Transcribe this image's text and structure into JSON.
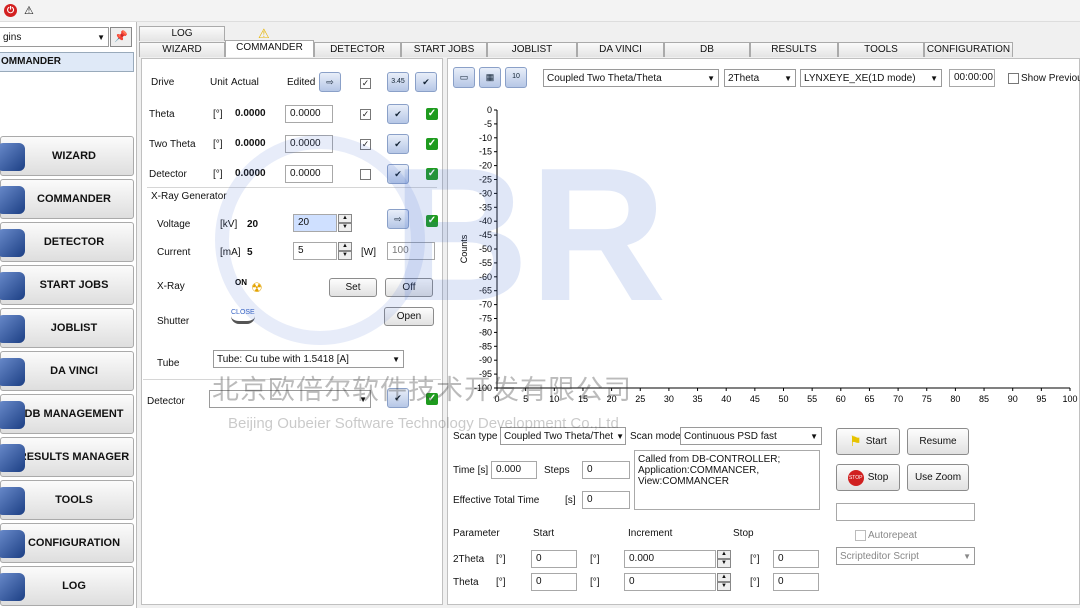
{
  "window": {
    "close_icon": "close-icon",
    "warning_icon": "warning-icon"
  },
  "sidebar": {
    "combo_value": "gins",
    "pin_icon": "pin-icon",
    "selected_item": "OMMANDER",
    "items": [
      {
        "label": "WIZARD",
        "icon": "wand-icon"
      },
      {
        "label": "COMMANDER",
        "icon": "commander-icon"
      },
      {
        "label": "DETECTOR",
        "icon": "detector-icon"
      },
      {
        "label": "START JOBS",
        "icon": "grid-icon"
      },
      {
        "label": "JOBLIST",
        "icon": "list-icon"
      },
      {
        "label": "DA VINCI",
        "icon": "davinci-icon"
      },
      {
        "label": "DB MANAGEMENT",
        "icon": "database-icon"
      },
      {
        "label": "RESULTS MANAGER",
        "icon": "results-icon"
      },
      {
        "label": "TOOLS",
        "icon": "tools-icon"
      },
      {
        "label": "CONFIGURATION",
        "icon": "configuration-icon"
      },
      {
        "label": "LOG",
        "icon": "log-icon"
      }
    ]
  },
  "tabs": {
    "top": [
      "LOG"
    ],
    "main": [
      "WIZARD",
      "COMMANDER",
      "DETECTOR",
      "START JOBS",
      "JOBLIST",
      "DA VINCI",
      "DB MANAGEMENT",
      "RESULTS MANAGER",
      "TOOLS",
      "CONFIGURATION"
    ],
    "active": "COMMANDER"
  },
  "commander": {
    "headers": {
      "drive": "Drive",
      "unit": "Unit",
      "actual": "Actual",
      "edited": "Edited"
    },
    "drives": [
      {
        "name": "Theta",
        "unit": "[°]",
        "actual": "0.0000",
        "edited": "0.0000",
        "checked": true
      },
      {
        "name": "Two Theta",
        "unit": "[°]",
        "actual": "0.0000",
        "edited": "0.0000",
        "checked": true
      },
      {
        "name": "Detector",
        "unit": "[°]",
        "actual": "0.0000",
        "edited": "0.0000",
        "checked": false
      }
    ],
    "xray_title": "X-Ray Generator",
    "voltage": {
      "label": "Voltage",
      "unit": "[kV]",
      "actual": "20",
      "edited": "20"
    },
    "current": {
      "label": "Current",
      "unit": "[mA]",
      "actual": "5",
      "edited": "5",
      "power_unit": "[W]",
      "power": "100"
    },
    "xray": {
      "label": "X-Ray",
      "status": "ON",
      "set_label": "Set",
      "off_label": "Off"
    },
    "shutter": {
      "label": "Shutter",
      "status": "CLOSE",
      "open_label": "Open"
    },
    "tube": {
      "label": "Tube",
      "value": "Tube: Cu tube with 1.5418 [A]"
    },
    "detector": {
      "label": "Detector",
      "value": ""
    }
  },
  "toolbar": {
    "scan_mode": "Coupled Two Theta/Theta",
    "axis": "2Theta",
    "detector": "LYNXEYE_XE(1D mode)",
    "time": "00:00:00",
    "show_previous": "Show Previous"
  },
  "chart_data": {
    "type": "line",
    "ylabel": "Counts",
    "xlim": [
      0,
      100
    ],
    "ylim": [
      -100,
      0
    ],
    "xticks": [
      0,
      5,
      10,
      15,
      20,
      25,
      30,
      35,
      40,
      45,
      50,
      55,
      60,
      65,
      70,
      75,
      80,
      85,
      90,
      95,
      100
    ],
    "yticks": [
      0,
      -5,
      -10,
      -15,
      -20,
      -25,
      -30,
      -35,
      -40,
      -45,
      -50,
      -55,
      -60,
      -65,
      -70,
      -75,
      -80,
      -85,
      -90,
      -95,
      -100
    ],
    "series": []
  },
  "scan": {
    "type_label": "Scan type",
    "type_value": "Coupled Two Theta/Thet",
    "mode_label": "Scan mode",
    "mode_value": "Continuous PSD fast",
    "time_label": "Time [s]",
    "time_value": "0.000",
    "steps_label": "Steps",
    "steps_value": "0",
    "eff_label": "Effective Total Time",
    "eff_unit": "[s]",
    "eff_value": "0",
    "message": "Called from DB-CONTROLLER;\nApplication:COMMANCER,\nView:COMMANCER",
    "param_headers": {
      "parameter": "Parameter",
      "start": "Start",
      "increment": "Increment",
      "stop": "Stop"
    },
    "params": [
      {
        "name": "2Theta",
        "unit": "[°]",
        "start": "0",
        "increment": "0.000",
        "stop": "0"
      },
      {
        "name": "Theta",
        "unit": "[°]",
        "start": "0",
        "increment": "0",
        "stop": "0"
      }
    ],
    "buttons": {
      "start": "Start",
      "resume": "Resume",
      "stop": "Stop",
      "zoom": "Use Zoom"
    },
    "autorepeat": "Autorepeat",
    "script": "Scripteditor Script"
  },
  "watermark": {
    "cn": "北京欧倍尔软件技术开发有限公司",
    "en": "Beijing Oubeier Software Technology Development Co.,Ltd",
    "logo": "BR"
  },
  "colors": {
    "accent": "#1c3f84",
    "green": "#1e9b1e",
    "watermark": "#4a6fd8"
  }
}
